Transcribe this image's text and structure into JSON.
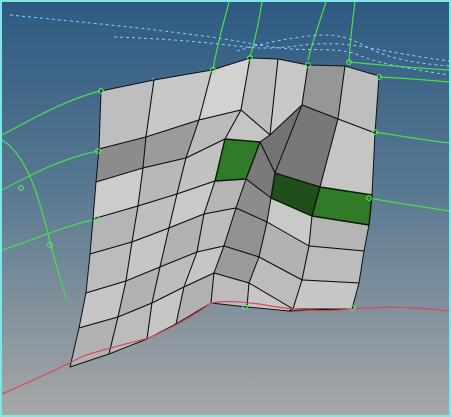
{
  "viewport": {
    "background_top": "#2e5a82",
    "background_bottom": "#a7a7a7",
    "frame_color": "#7fe6e6"
  },
  "mesh": {
    "edge_color": "#111111",
    "base_color": "#c7c7c7",
    "highlight_color": "#2f7b28",
    "dark_highlight_color": "#214f1b",
    "selected_faces": 3
  },
  "geometry_lines": {
    "construction_color": "#48e04a",
    "boundary_color": "#d84a5a",
    "dashed_color": "#89c9ff",
    "vertex_color": "#59ea64"
  }
}
